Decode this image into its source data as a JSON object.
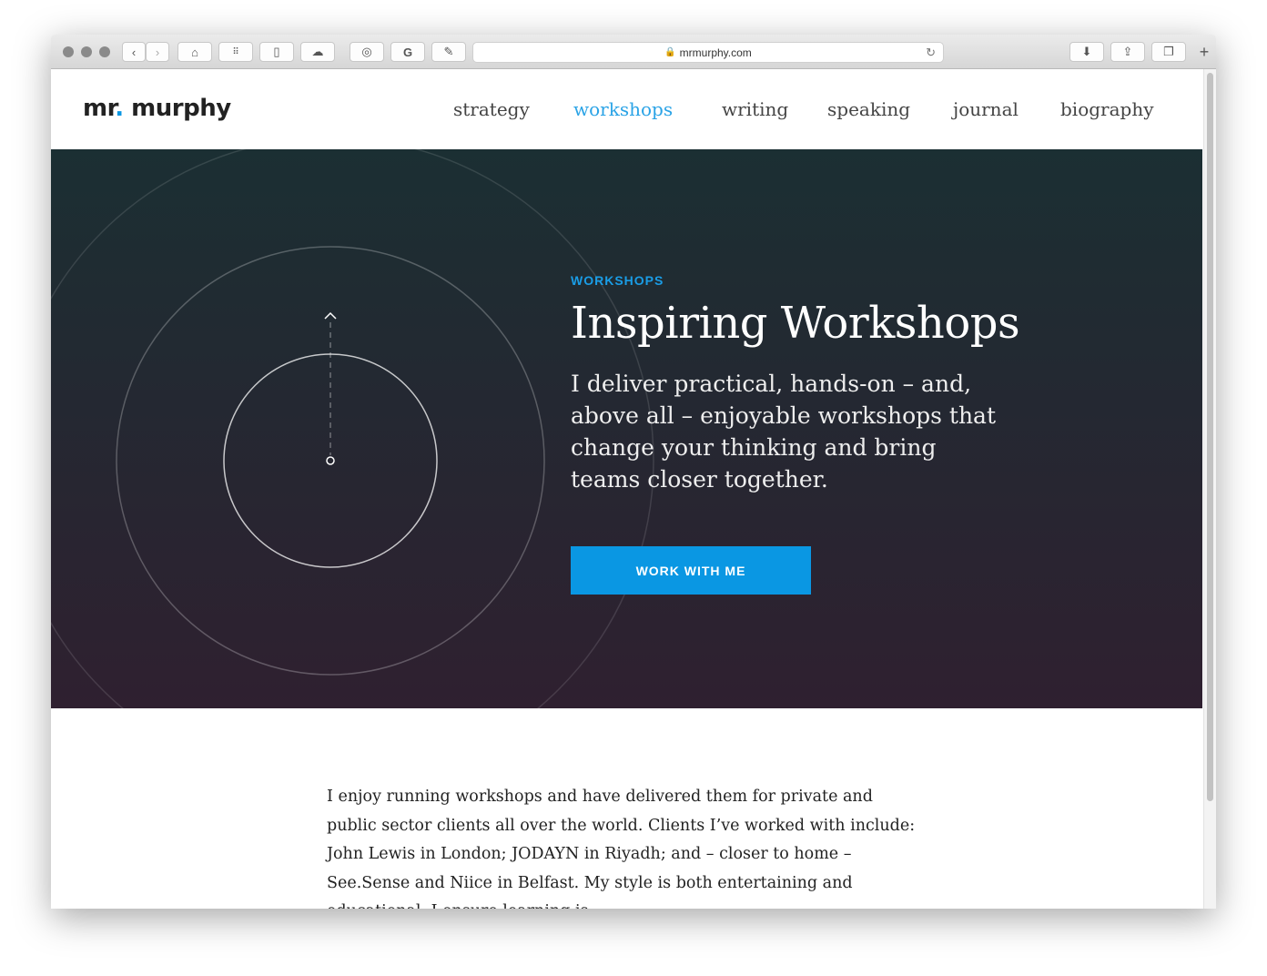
{
  "browser": {
    "url": "mrmurphy.com"
  },
  "header": {
    "logo_main": "mr",
    "logo_dot": ".",
    "logo_rest": " murphy",
    "nav": [
      {
        "label": "strategy"
      },
      {
        "label": "workshops",
        "active": true
      },
      {
        "label": "writing"
      },
      {
        "label": "speaking"
      },
      {
        "label": "journal"
      },
      {
        "label": "biography"
      }
    ]
  },
  "hero": {
    "eyebrow": "WORKSHOPS",
    "title": "Inspiring Workshops",
    "lead": "I deliver practical, hands-on – and, above all – enjoyable workshops that change your thinking and bring teams closer together.",
    "cta": "WORK WITH ME"
  },
  "content": {
    "paragraph": "I enjoy running workshops and have delivered them for private and public sector clients all over the world. Clients I’ve worked with include: John Lewis in London; JODAYN in Riyadh; and – closer to home – See.Sense and Niice in Belfast.  My style is both entertaining and educational. I ensure learning is"
  },
  "colors": {
    "accent": "#0a97e3",
    "hero_top": "#1b2f33",
    "hero_bottom": "#2f2030"
  }
}
